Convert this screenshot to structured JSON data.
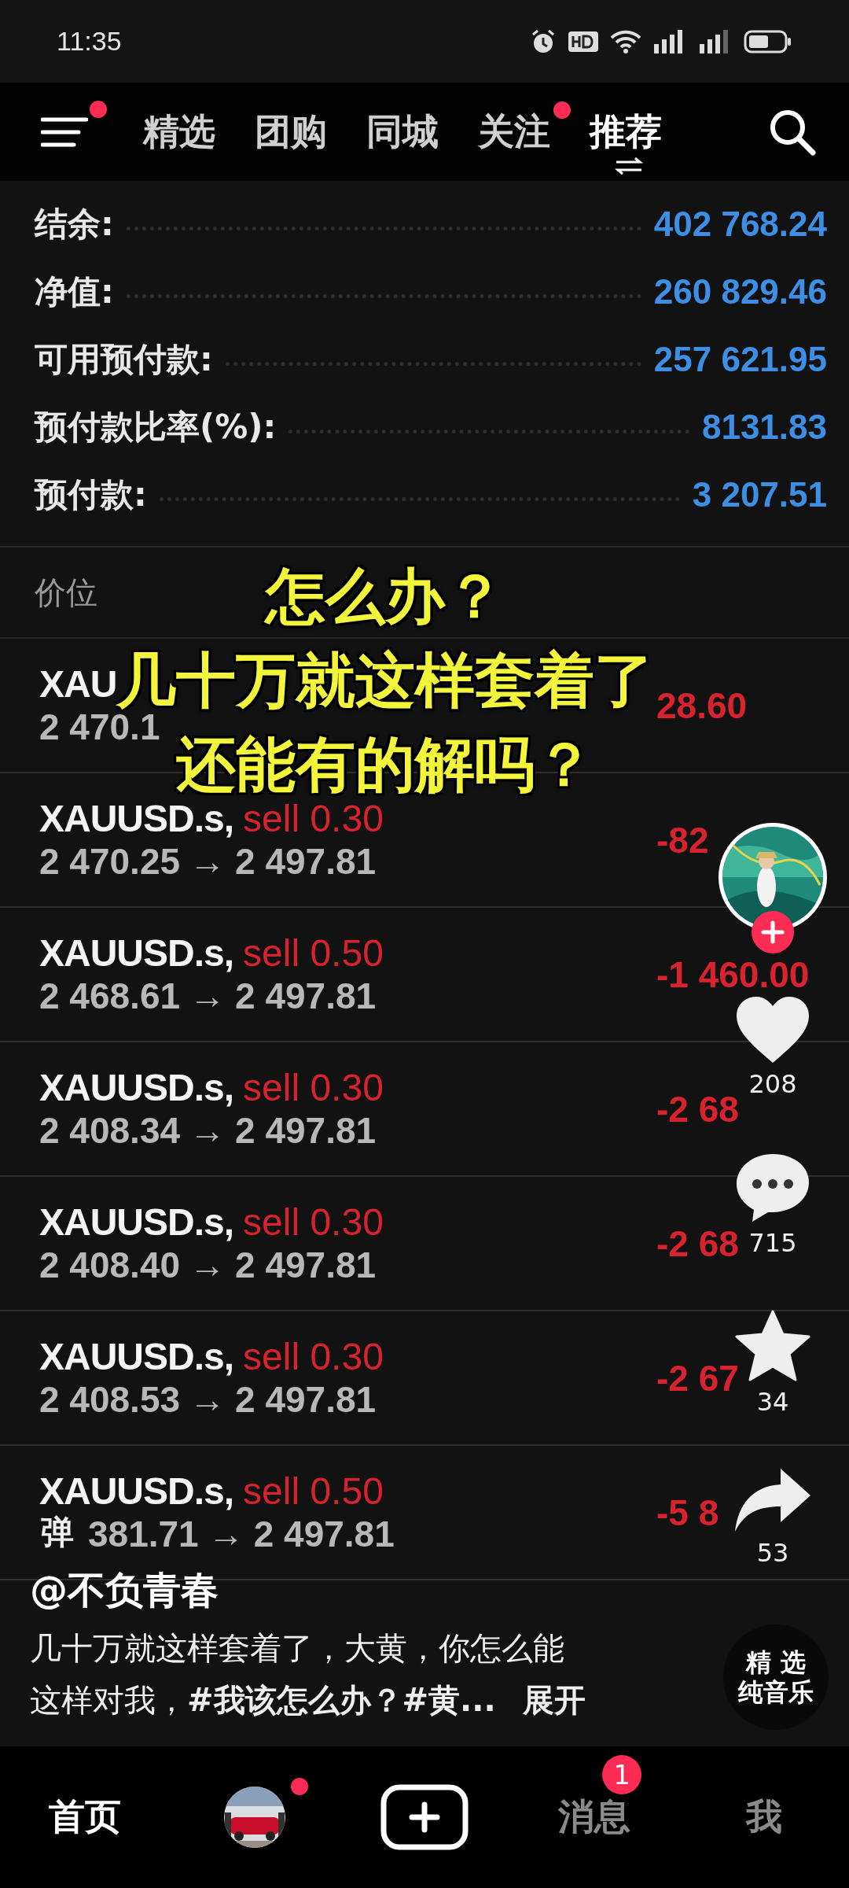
{
  "status_bar": {
    "time": "11:35"
  },
  "top_nav": {
    "menu_dot": true,
    "tabs": [
      {
        "label": "精选",
        "selected": false,
        "dot": false
      },
      {
        "label": "团购",
        "selected": false,
        "dot": false
      },
      {
        "label": "同城",
        "selected": false,
        "dot": false
      },
      {
        "label": "关注",
        "selected": false,
        "dot": true
      },
      {
        "label": "推荐",
        "selected": true,
        "dot": false
      }
    ]
  },
  "video": {
    "account": [
      {
        "label": "结余:",
        "value": "402 768.24"
      },
      {
        "label": "净值:",
        "value": "260 829.46"
      },
      {
        "label": "可用预付款:",
        "value": "257 621.95"
      },
      {
        "label": "预付款比率(%):",
        "value": "8131.83"
      },
      {
        "label": "预付款:",
        "value": "3 207.51"
      }
    ],
    "price_header": "价位",
    "positions": [
      {
        "symbol": "XAU",
        "from": "2 470.1",
        "profit": "28.60"
      },
      {
        "symbol": "XAUUSD.s,",
        "side": "sell 0.30",
        "from": "2 470.25",
        "arrow": "→",
        "to": "2 497.81",
        "profit": "-82"
      },
      {
        "symbol": "XAUUSD.s,",
        "side": "sell 0.50",
        "from": "2 468.61",
        "arrow": "→",
        "to": "2 497.81",
        "profit": "-1 460.00"
      },
      {
        "symbol": "XAUUSD.s,",
        "side": "sell 0.30",
        "from": "2 408.34",
        "arrow": "→",
        "to": "2 497.81",
        "profit": "-2 68"
      },
      {
        "symbol": "XAUUSD.s,",
        "side": "sell 0.30",
        "from": "2 408.40",
        "arrow": "→",
        "to": "2 497.81",
        "profit": "-2 68"
      },
      {
        "symbol": "XAUUSD.s,",
        "side": "sell 0.30",
        "from": "2 408.53",
        "arrow": "→",
        "to": "2 497.81",
        "profit": "-2 67"
      },
      {
        "symbol": "XAUUSD.s,",
        "side": "sell 0.50",
        "from": "381.71",
        "arrow": "→",
        "to": "2 497.81",
        "profit": "-5 8"
      }
    ],
    "caption": [
      "怎么办？",
      "几十万就这样套着了",
      "还能有的解吗？"
    ]
  },
  "danmaku": "弹",
  "actions": [
    {
      "kind": "like",
      "count": "208"
    },
    {
      "kind": "comment",
      "count": "715"
    },
    {
      "kind": "favorite",
      "count": "34"
    },
    {
      "kind": "share",
      "count": "53"
    }
  ],
  "author": "@不负青春",
  "description": [
    "几十万就这样套着了，大黄，你怎么能",
    "这样对我，**#我该怎么办？#黄...**"
  ],
  "expand": "展开",
  "music": [
    "精 选",
    "纯音乐"
  ],
  "bottom_nav": [
    {
      "kind": "text",
      "label": "首页",
      "selected": true
    },
    {
      "kind": "avatar",
      "dot": true
    },
    {
      "kind": "create"
    },
    {
      "kind": "text",
      "label": "消息",
      "selected": false,
      "badge": "1"
    },
    {
      "kind": "text",
      "label": "我",
      "selected": false
    }
  ]
}
